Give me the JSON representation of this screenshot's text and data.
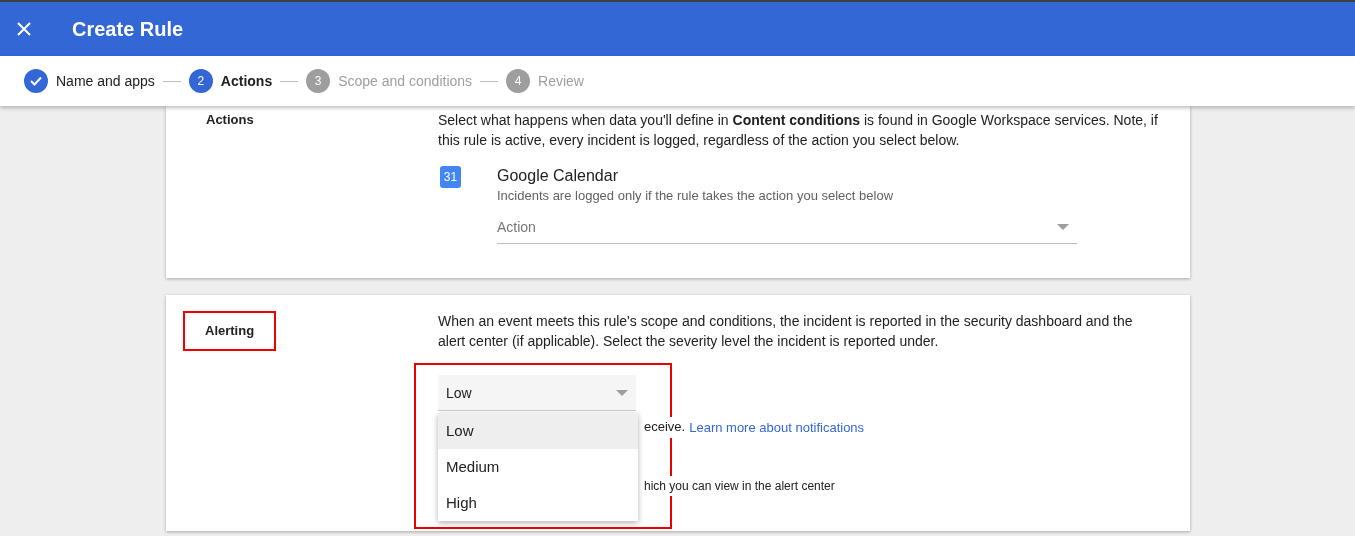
{
  "header": {
    "title": "Create Rule"
  },
  "steps": [
    {
      "label": "Name and apps",
      "completed": true,
      "selected": false
    },
    {
      "number": "2",
      "label": "Actions",
      "completed": false,
      "selected": true
    },
    {
      "number": "3",
      "label": "Scope and conditions",
      "completed": false,
      "selected": false
    },
    {
      "number": "4",
      "label": "Review",
      "completed": false,
      "selected": false
    }
  ],
  "actions_section": {
    "heading": "Actions",
    "description": "Select what happens when data you'll define in **Content conditions** is found in Google Workspace services. Note, if this rule is active, every incident is logged, regardless of the action you select below.",
    "app": {
      "icon_text": "31",
      "name": "Google Calendar",
      "hint": "Incidents are logged only if the rule takes the action you select below",
      "select": {
        "placeholder": "Action"
      }
    }
  },
  "alerting_section": {
    "heading": "Alerting",
    "highlighted": true,
    "description": "When an event meets this rule's scope and conditions, the incident is reported in the security dashboard and the alert center (if applicable). Select the severity level the incident is reported under.",
    "select": {
      "value": "Low",
      "expanded": true,
      "highlighted": true,
      "options": [
        {
          "label": "Low",
          "selected": true
        },
        {
          "label": "Medium",
          "selected": false
        },
        {
          "label": "High",
          "selected": false
        }
      ]
    },
    "notify_text": "eceive.",
    "notify_link": "Learn more about notifications",
    "alert_center_text": "hich you can view in the alert center"
  }
}
